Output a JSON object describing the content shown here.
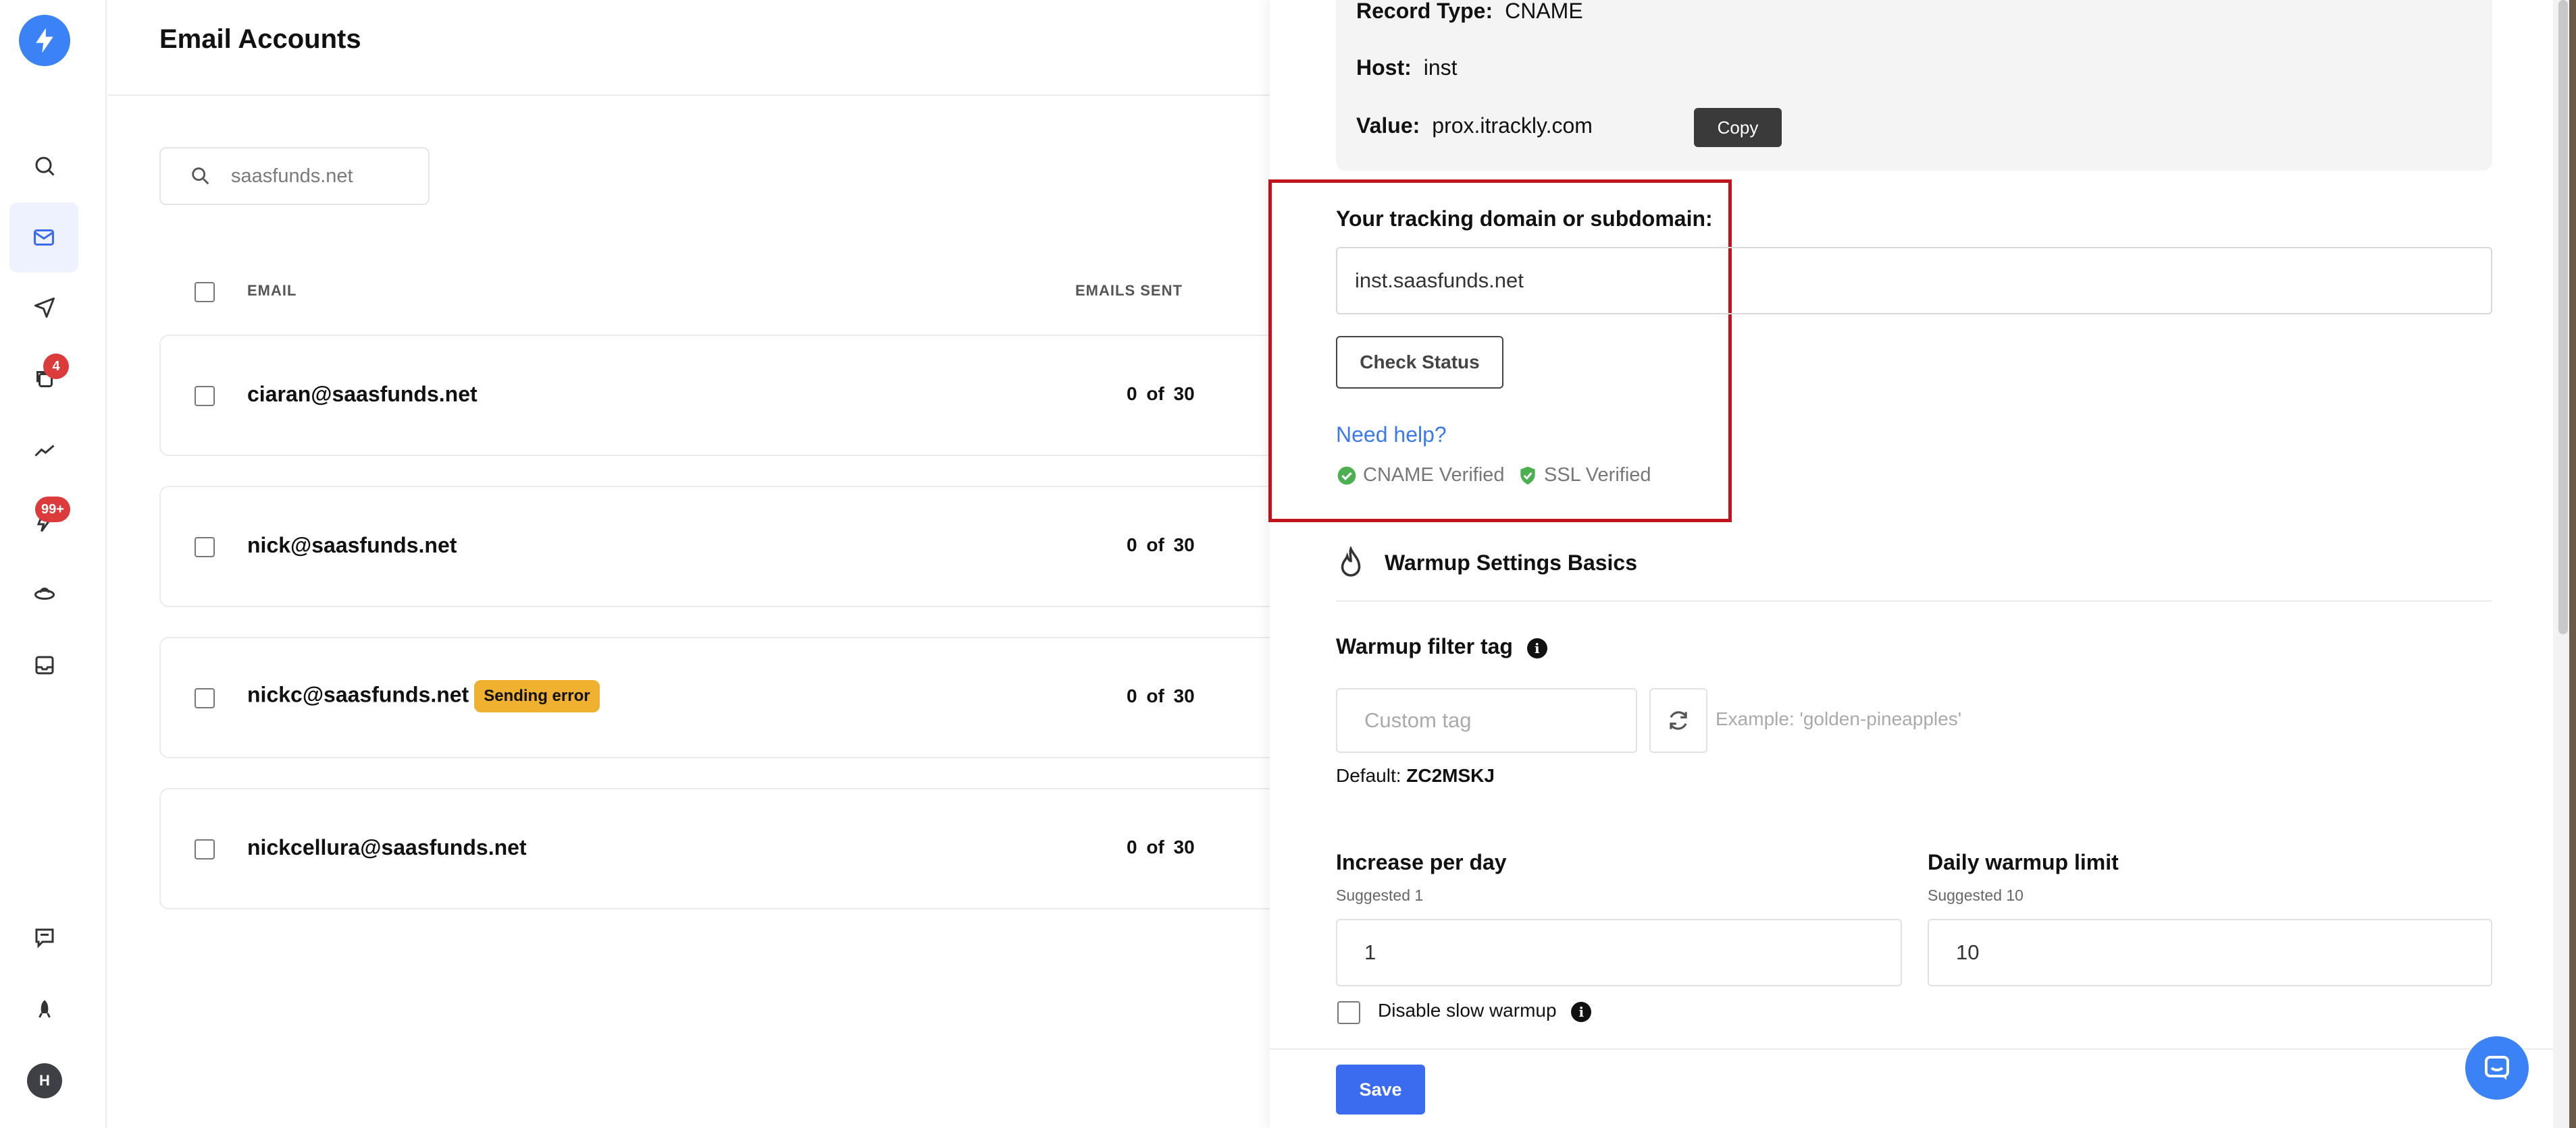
{
  "sidebar": {
    "badges": {
      "campaigns_count": "4",
      "unibox_count": "99+"
    },
    "avatar_initial": "H"
  },
  "main": {
    "title": "Email Accounts",
    "search_value": "saasfunds.net",
    "columns": {
      "email": "EMAIL",
      "emails_sent": "EMAILS SENT"
    },
    "rows": [
      {
        "email": "ciaran@saasfunds.net",
        "sent": "0 of 30",
        "badge": ""
      },
      {
        "email": "nick@saasfunds.net",
        "sent": "0 of 30",
        "badge": ""
      },
      {
        "email": "nickc@saasfunds.net",
        "sent": "0 of 30",
        "badge": "Sending error"
      },
      {
        "email": "nickcellura@saasfunds.net",
        "sent": "0 of 30",
        "badge": ""
      }
    ]
  },
  "panel": {
    "dns": {
      "record_type_label": "Record Type:",
      "record_type": "CNAME",
      "host_label": "Host:",
      "host": "inst",
      "value_label": "Value:",
      "value": "prox.itrackly.com",
      "copy_label": "Copy"
    },
    "tracking": {
      "label": "Your tracking domain or subdomain:",
      "value": "inst.saasfunds.net",
      "check_label": "Check Status",
      "help_label": "Need help?",
      "cname_verified": "CNAME Verified",
      "ssl_verified": "SSL Verified"
    },
    "warmup": {
      "section_title": "Warmup Settings Basics",
      "filter_tag_label": "Warmup filter tag",
      "custom_tag_placeholder": "Custom tag",
      "example": "Example: 'golden-pineapples'",
      "default_label": "Default:",
      "default_value": "ZC2MSKJ",
      "increase_label": "Increase per day",
      "increase_hint": "Suggested 1",
      "increase_value": "1",
      "limit_label": "Daily warmup limit",
      "limit_hint": "Suggested 10",
      "limit_value": "10",
      "slow_label": "Disable slow warmup"
    },
    "save_label": "Save"
  },
  "colors": {
    "accent": "#3b82f6",
    "save": "#3b6cf0",
    "highlight": "#c0141c",
    "warning": "#f0b030",
    "verified": "#4caf50",
    "badge": "#dc3b3b"
  }
}
